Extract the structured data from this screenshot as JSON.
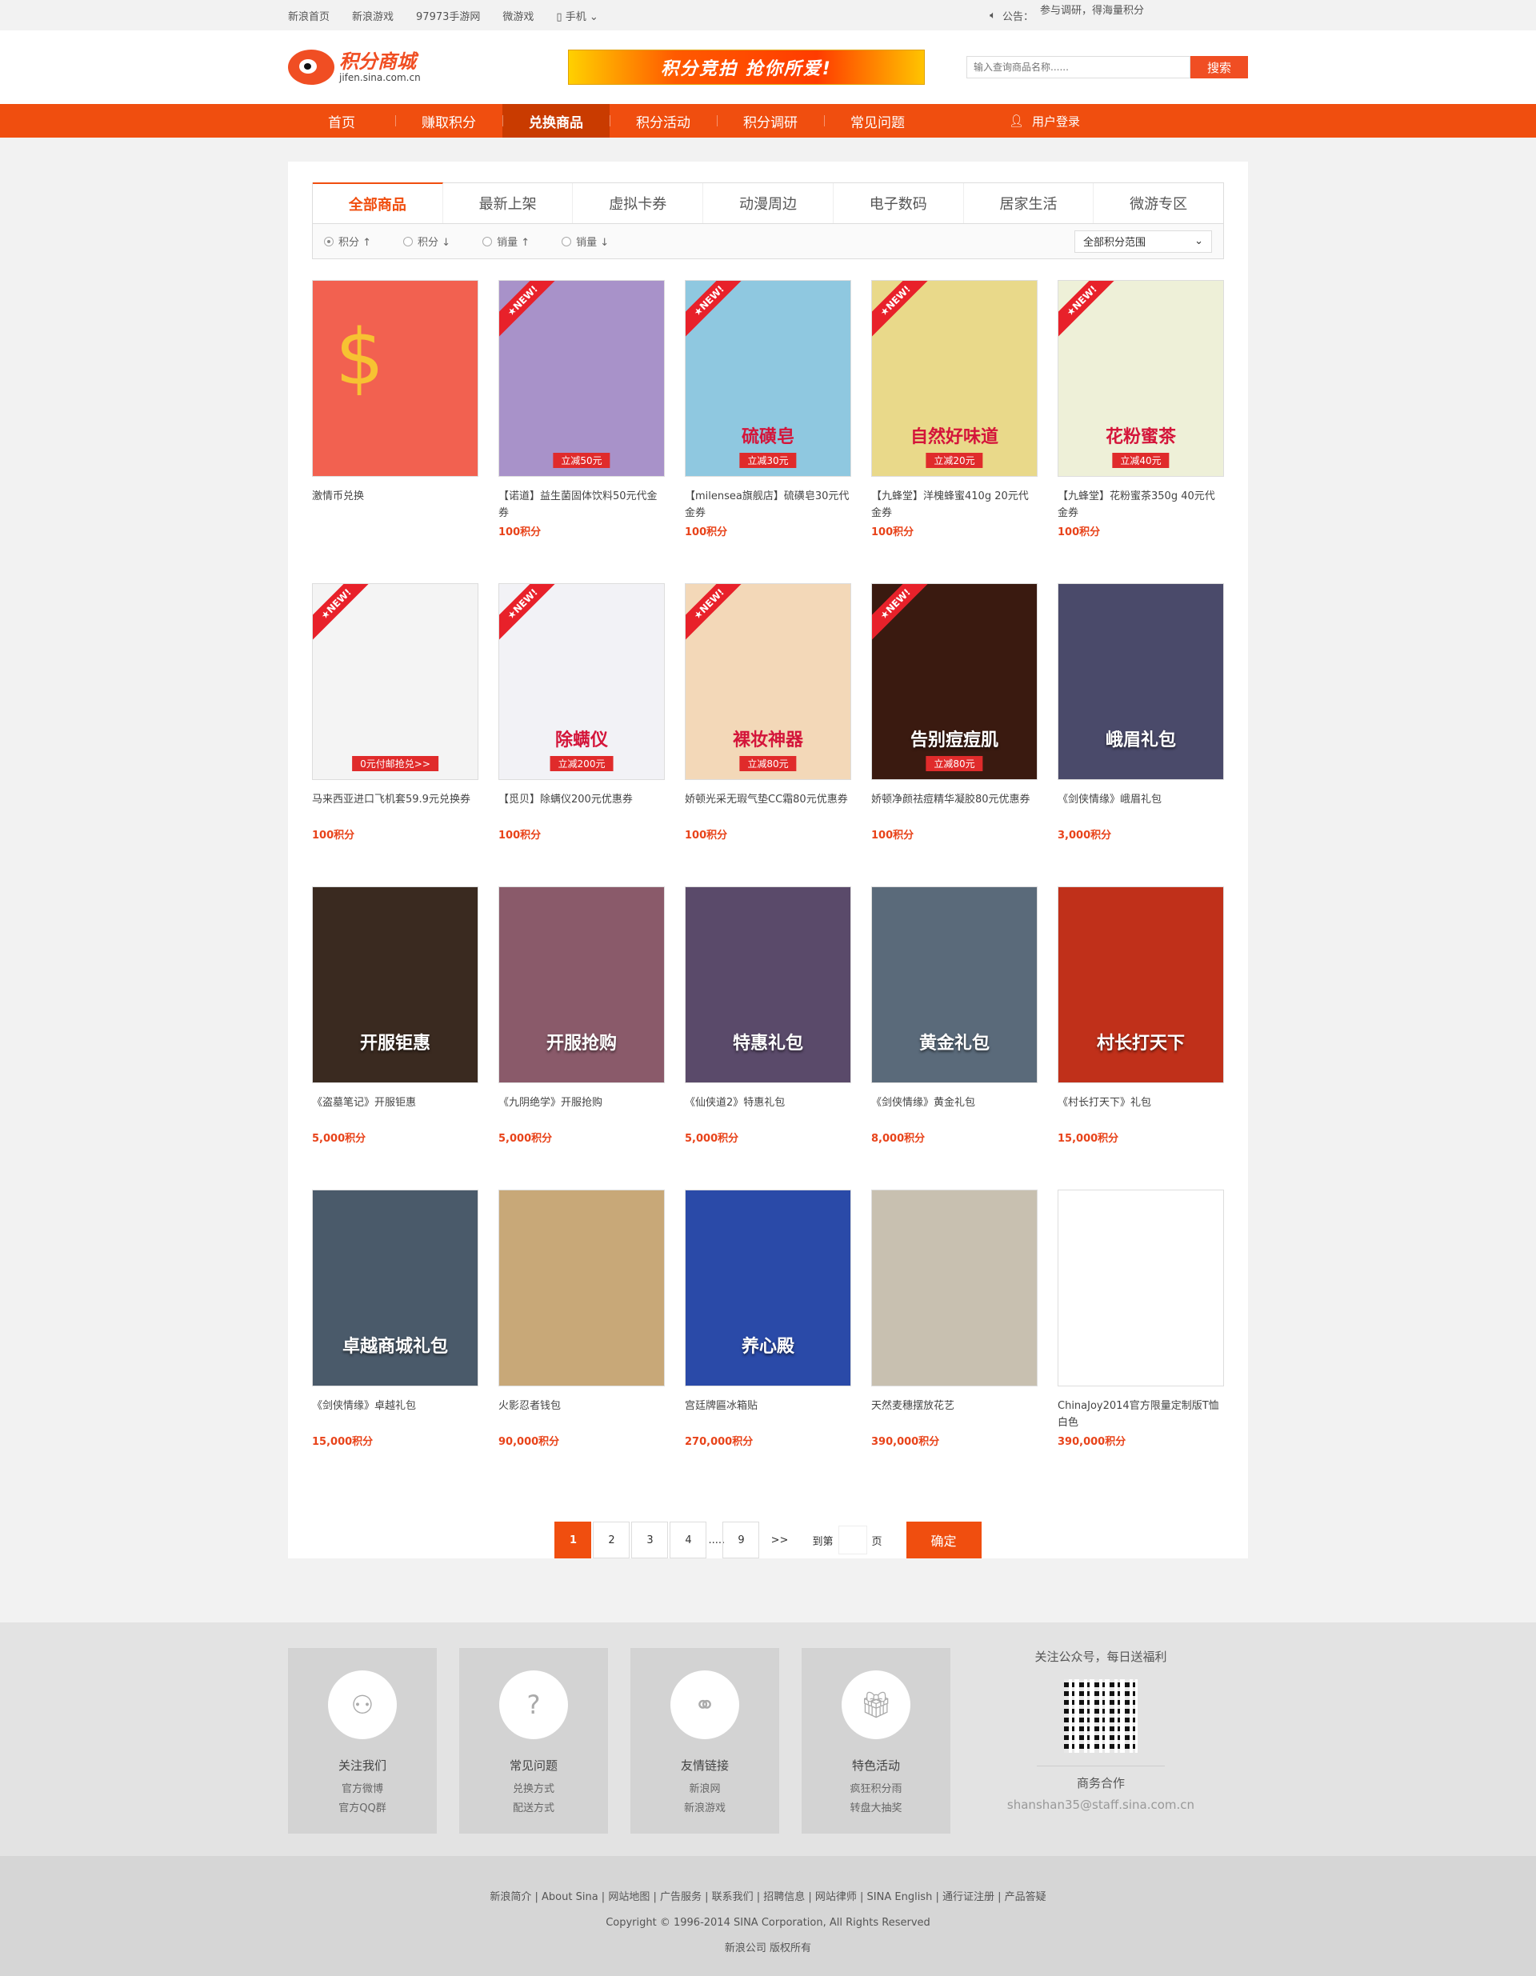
{
  "topbar": {
    "links": [
      "新浪首页",
      "新浪游戏",
      "97973手游网",
      "微游戏",
      "手机"
    ],
    "notice_label": "公告：",
    "notice_text": "参与调研，得海量积分"
  },
  "header": {
    "logo_title": "积分商城",
    "logo_url_text": "jifen.sina.com.cn",
    "banner_text": "积分竞拍 抢你所爱!",
    "search_placeholder": "输入查询商品名称......",
    "search_button": "搜索"
  },
  "nav": {
    "items": [
      "首页",
      "赚取积分",
      "兑换商品",
      "积分活动",
      "积分调研",
      "常见问题"
    ],
    "active_index": 2,
    "login": "用户登录"
  },
  "tabs": [
    "全部商品",
    "最新上架",
    "虚拟卡券",
    "动漫周边",
    "电子数码",
    "居家生活",
    "微游专区"
  ],
  "filters": {
    "sorts": [
      "积分 ↑",
      "积分 ↓",
      "销量 ↑",
      "销量 ↓"
    ],
    "range": "全部积分范围"
  },
  "products": [
    {
      "name": "激情币兑换",
      "points": "",
      "is_new": false,
      "caption": "",
      "tag": "",
      "bg": "#f26150"
    },
    {
      "name": "【诺道】益生菌固体饮料50元代金券",
      "points": "100积分",
      "is_new": true,
      "caption": "",
      "tag": "立减50元",
      "bg": "#a892c9"
    },
    {
      "name": "【milensea旗舰店】硫磺皂30元代金券",
      "points": "100积分",
      "is_new": true,
      "caption": "硫磺皂",
      "tag": "立减30元",
      "bg": "#8fc8e0"
    },
    {
      "name": "【九蜂堂】洋槐蜂蜜410g 20元代金券",
      "points": "100积分",
      "is_new": true,
      "caption": "自然好味道",
      "tag": "立减20元",
      "bg": "#e9d98a"
    },
    {
      "name": "【九蜂堂】花粉蜜茶350g 40元代金券",
      "points": "100积分",
      "is_new": true,
      "caption": "花粉蜜茶",
      "tag": "立减40元",
      "bg": "#eef0d8"
    },
    {
      "name": "马来西亚进口飞机套59.9元兑换券",
      "points": "100积分",
      "is_new": true,
      "caption": "",
      "tag": "0元付邮抢兑>>",
      "bg": "#f4f4f4"
    },
    {
      "name": "【觅贝】除螨仪200元优惠券",
      "points": "100积分",
      "is_new": true,
      "caption": "除螨仪",
      "tag": "立减200元",
      "bg": "#f2f2f6"
    },
    {
      "name": "娇顿光采无瑕气垫CC霜80元优惠券",
      "points": "100积分",
      "is_new": true,
      "caption": "裸妆神器",
      "tag": "立减80元",
      "bg": "#f3d8b8"
    },
    {
      "name": "娇顿净颜祛痘精华凝胶80元优惠券",
      "points": "100积分",
      "is_new": true,
      "caption": "告别痘痘肌",
      "tag": "立减80元",
      "bg": "#3a1a10"
    },
    {
      "name": "《剑侠情缘》峨眉礼包",
      "points": "3,000积分",
      "is_new": false,
      "caption": "峨眉礼包",
      "tag": "",
      "bg": "#4a4a6a"
    },
    {
      "name": "《盗墓笔记》开服钜惠",
      "points": "5,000积分",
      "is_new": false,
      "caption": "开服钜惠",
      "tag": "",
      "bg": "#3a2a20"
    },
    {
      "name": "《九阴绝学》开服抢购",
      "points": "5,000积分",
      "is_new": false,
      "caption": "开服抢购",
      "tag": "",
      "bg": "#8a5a6a"
    },
    {
      "name": "《仙侠道2》特惠礼包",
      "points": "5,000积分",
      "is_new": false,
      "caption": "特惠礼包",
      "tag": "",
      "bg": "#5a4a6a"
    },
    {
      "name": "《剑侠情缘》黄金礼包",
      "points": "8,000积分",
      "is_new": false,
      "caption": "黄金礼包",
      "tag": "",
      "bg": "#5a6a7a"
    },
    {
      "name": "《村长打天下》礼包",
      "points": "15,000积分",
      "is_new": false,
      "caption": "村长打天下",
      "tag": "",
      "bg": "#c0301a"
    },
    {
      "name": "《剑侠情缘》卓越礼包",
      "points": "15,000积分",
      "is_new": false,
      "caption": "卓越商城礼包",
      "tag": "",
      "bg": "#4a5a6a"
    },
    {
      "name": "火影忍者钱包",
      "points": "90,000积分",
      "is_new": false,
      "caption": "",
      "tag": "",
      "bg": "#c8a878"
    },
    {
      "name": "宫廷牌匾冰箱贴",
      "points": "270,000积分",
      "is_new": false,
      "caption": "养心殿",
      "tag": "",
      "bg": "#2a4aa8"
    },
    {
      "name": "天然麦穗摆放花艺",
      "points": "390,000积分",
      "is_new": false,
      "caption": "",
      "tag": "",
      "bg": "#c8c0b0"
    },
    {
      "name": "ChinaJoy2014官方限量定制版T恤白色",
      "points": "390,000积分",
      "is_new": false,
      "caption": "",
      "tag": "",
      "bg": "#ffffff"
    }
  ],
  "pager": {
    "pages": [
      "1",
      "2",
      "3",
      "4",
      "9"
    ],
    "dots": ".....",
    "next": ">>",
    "goto_label": "到第",
    "page_unit": "页",
    "confirm": "确定"
  },
  "footer": {
    "boxes": [
      {
        "title": "关注我们",
        "lines": [
          "官方微博",
          "官方QQ群"
        ],
        "icon": "user-add-icon"
      },
      {
        "title": "常见问题",
        "lines": [
          "兑换方式",
          "配送方式"
        ],
        "icon": "question-icon"
      },
      {
        "title": "友情链接",
        "lines": [
          "新浪网",
          "新浪游戏"
        ],
        "icon": "link-icon"
      },
      {
        "title": "特色活动",
        "lines": [
          "疯狂积分雨",
          "转盘大抽奖"
        ],
        "icon": "gift-icon"
      }
    ],
    "qr_title": "关注公众号，每日送福利",
    "biz_title": "商务合作",
    "biz_mail": "shanshan35@staff.sina.com.cn",
    "bottom_links": "新浪简介 | About Sina | 网站地图 | 广告服务 | 联系我们 | 招聘信息 | 网站律师 | SINA English | 通行证注册 | 产品答疑",
    "copyright": "Copyright © 1996-2014 SINA Corporation, All Rights Reserved",
    "rights": "新浪公司 版权所有"
  }
}
